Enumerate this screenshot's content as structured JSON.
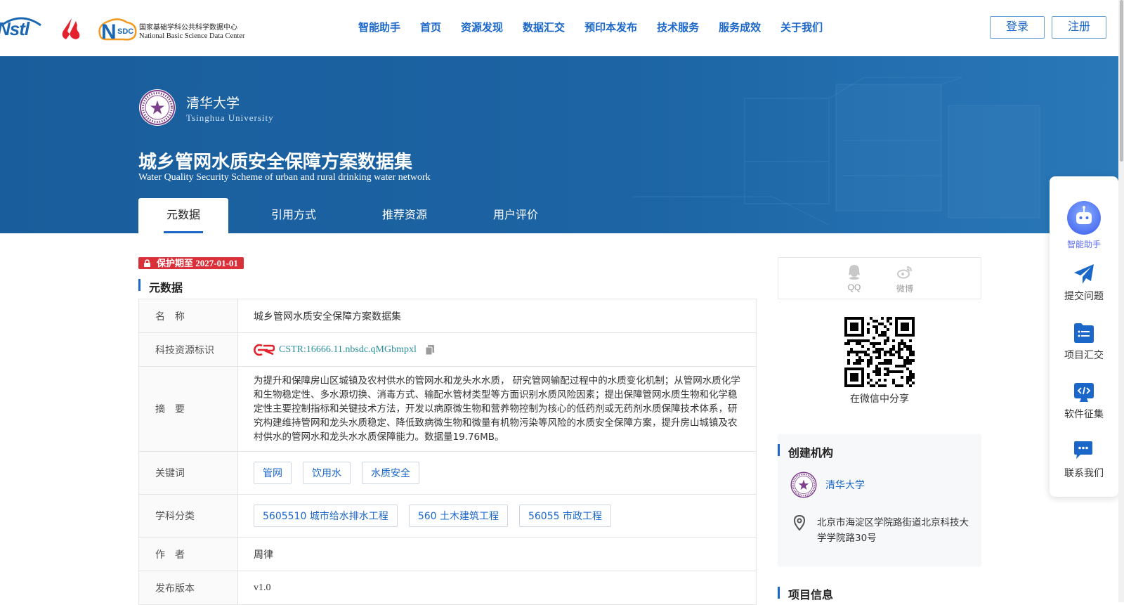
{
  "header": {
    "logos": {
      "nstl": "Nstl",
      "nsdc_mark": "SDC",
      "nsdc_cn": "国家基础学科公共科学数据中心",
      "nsdc_en": "National Basic Science Data Center"
    },
    "nav": [
      "智能助手",
      "首页",
      "资源发现",
      "数据汇交",
      "预印本发布",
      "技术服务",
      "服务成效",
      "关于我们"
    ],
    "login": "登录",
    "register": "注册"
  },
  "banner": {
    "org_cn": "清华大学",
    "org_en": "Tsinghua University",
    "title": "城乡管网水质安全保障方案数据集",
    "subtitle": "Water Quality Security Scheme of urban and rural drinking water network",
    "tabs": [
      "元数据",
      "引用方式",
      "推荐资源",
      "用户评价"
    ],
    "active_tab": "元数据"
  },
  "main": {
    "protection": "保护期至 2027-01-01",
    "section_title": "元数据",
    "rows": {
      "name_label": "名　称",
      "name_value": "城乡管网水质安全保障方案数据集",
      "id_label": "科技资源标识",
      "id_value": "CSTR:16666.11.nbsdc.qMGbmpxl",
      "abstract_label": "摘　要",
      "abstract_value": "为提升和保障房山区城镇及农村供水的管网水和龙头水水质， 研究管网输配过程中的水质变化机制；从管网水质化学和生物稳定性、多水源切换、消毒方式、输配水管材类型等方面识别水质风险因素；提出保障管网水质生物和化学稳定性主要控制指标和关键技术方法，开发以病原微生物和营养物控制为核心的低药剂或无药剂水质保障技术体系，研究构建维持管网和龙头水质稳定、降低致病微生物和微量有机物污染等风险的水质安全保障方案，提升房山城镇及农村供水的管网水和龙头水水质保障能力。数据量19.76MB。",
      "keywords_label": "关键词",
      "keywords": [
        "管网",
        "饮用水",
        "水质安全"
      ],
      "subject_label": "学科分类",
      "subjects": [
        "5605510 城市给水排水工程",
        "560 土木建筑工程",
        "56055 市政工程"
      ],
      "author_label": "作　者",
      "author_value": "周律",
      "version_label": "发布版本",
      "version_value": "v1.0"
    }
  },
  "sidebar": {
    "share_qq": "QQ",
    "share_weibo": "微博",
    "qr_label": "在微信中分享",
    "org_section": "创建机构",
    "org_name": "清华大学",
    "org_address": "北京市海淀区学院路街道北京科技大学学院路30号",
    "project_section": "项目信息"
  },
  "float_panel": {
    "items": [
      {
        "label": "智能助手",
        "icon": "robot-icon"
      },
      {
        "label": "提交问题",
        "icon": "paper-plane-icon"
      },
      {
        "label": "项目汇交",
        "icon": "list-icon"
      },
      {
        "label": "软件征集",
        "icon": "code-icon"
      },
      {
        "label": "联系我们",
        "icon": "chat-icon"
      }
    ]
  },
  "colors": {
    "primary": "#1b67c9",
    "banner": "#1c64a4",
    "protect_badge": "#d9303a",
    "cstr_link": "#2a8f9a",
    "tsinghua_purple": "#7d3f8c"
  }
}
